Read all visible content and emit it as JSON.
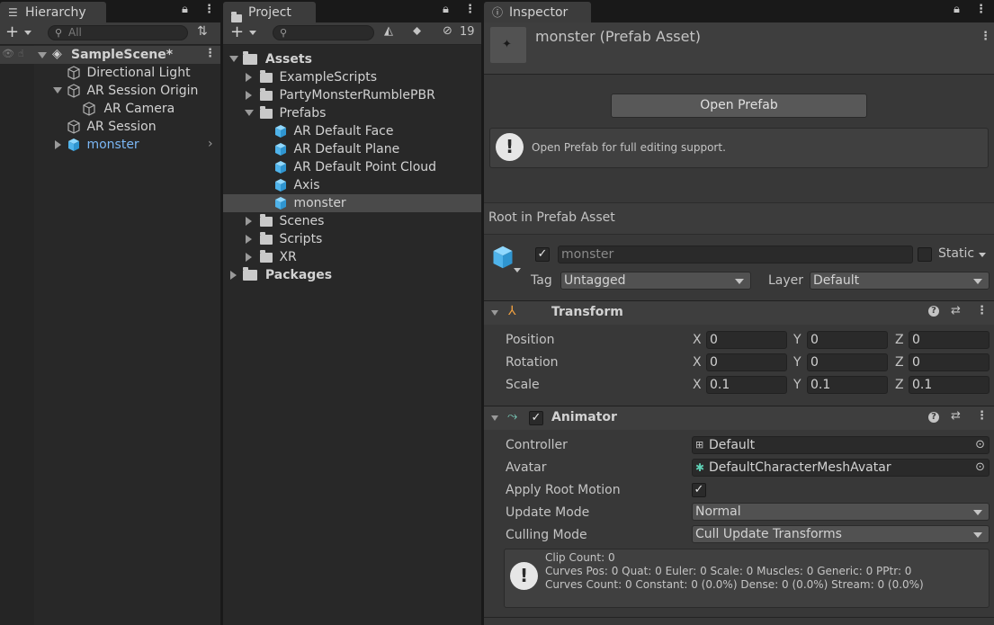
{
  "hierarchy": {
    "tab_label": "Hierarchy",
    "search_placeholder": "All",
    "scene_name": "SampleScene*",
    "items": [
      {
        "label": "Directional Light"
      },
      {
        "label": "AR Session Origin"
      },
      {
        "label": "AR Camera"
      },
      {
        "label": "AR Session"
      },
      {
        "label": "monster"
      }
    ]
  },
  "project": {
    "tab_label": "Project",
    "hidden_count": "19",
    "assets_label": "Assets",
    "example_scripts": "ExampleScripts",
    "party_monster": "PartyMonsterRumblePBR",
    "prefabs": "Prefabs",
    "prefab_items": [
      "AR Default Face",
      "AR Default Plane",
      "AR Default Point Cloud",
      "Axis",
      "monster"
    ],
    "scenes": "Scenes",
    "scripts": "Scripts",
    "xr": "XR",
    "packages": "Packages"
  },
  "inspector": {
    "tab_label": "Inspector",
    "asset_title": "monster (Prefab Asset)",
    "open_prefab": "Open Prefab",
    "info_message": "Open Prefab for full editing support.",
    "root_label": "Root in Prefab Asset",
    "object_name": "monster",
    "static_label": "Static",
    "tag_label": "Tag",
    "tag_value": "Untagged",
    "layer_label": "Layer",
    "layer_value": "Default"
  },
  "transform": {
    "title": "Transform",
    "rows": [
      {
        "label": "Position",
        "x": "0",
        "y": "0",
        "z": "0"
      },
      {
        "label": "Rotation",
        "x": "0",
        "y": "0",
        "z": "0"
      },
      {
        "label": "Scale",
        "x": "0.1",
        "y": "0.1",
        "z": "0.1"
      }
    ],
    "axis_x": "X",
    "axis_y": "Y",
    "axis_z": "Z"
  },
  "animator": {
    "title": "Animator",
    "controller_label": "Controller",
    "controller_value": "Default",
    "avatar_label": "Avatar",
    "avatar_value": "DefaultCharacterMeshAvatar",
    "apply_root_label": "Apply Root Motion",
    "update_mode_label": "Update Mode",
    "update_mode_value": "Normal",
    "culling_mode_label": "Culling Mode",
    "culling_mode_value": "Cull Update Transforms",
    "stats_line1": "Clip Count: 0",
    "stats_line2": "Curves Pos: 0 Quat: 0 Euler: 0 Scale: 0 Muscles: 0 Generic: 0 PPtr: 0",
    "stats_line3": "Curves Count: 0 Constant: 0 (0.0%) Dense: 0 (0.0%) Stream: 0 (0.0%)"
  },
  "colors": {
    "accent_blue": "#7bb7f5",
    "cube_blue": "#5fc3f6",
    "panel_bg": "#282828",
    "selected_row": "#4a4a4a"
  }
}
